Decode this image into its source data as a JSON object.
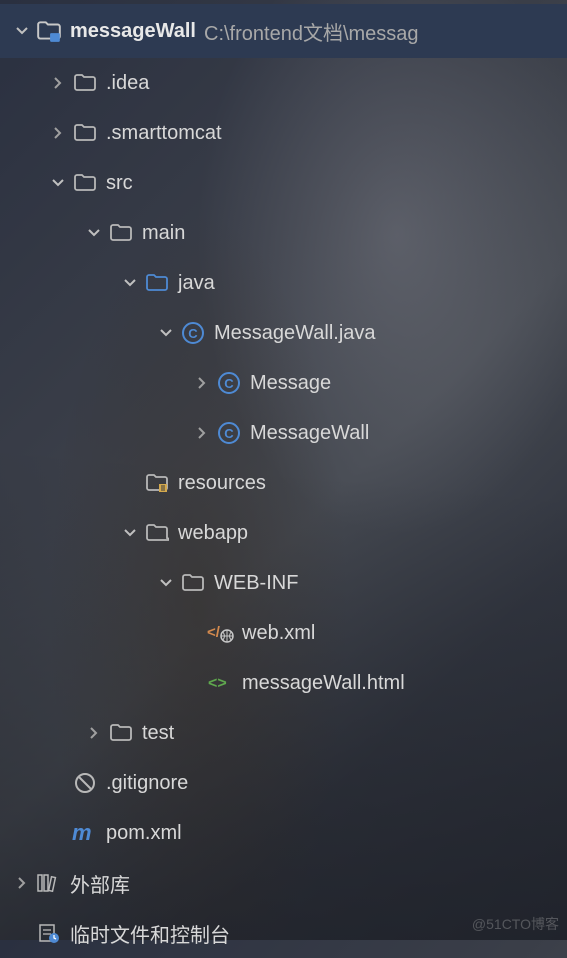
{
  "root": {
    "name": "messageWall",
    "path": "C:\\frontend文档\\messag"
  },
  "nodes": {
    "idea": ".idea",
    "smarttomcat": ".smarttomcat",
    "src": "src",
    "main": "main",
    "java": "java",
    "messagewall_java": "MessageWall.java",
    "message_class": "Message",
    "messagewall_class": "MessageWall",
    "resources": "resources",
    "webapp": "webapp",
    "webinf": "WEB-INF",
    "webxml": "web.xml",
    "messagewall_html": "messageWall.html",
    "test": "test",
    "gitignore": ".gitignore",
    "pomxml": "pom.xml",
    "external_libs": "外部库",
    "scratches": "临时文件和控制台"
  },
  "watermark": "@51CTO博客"
}
